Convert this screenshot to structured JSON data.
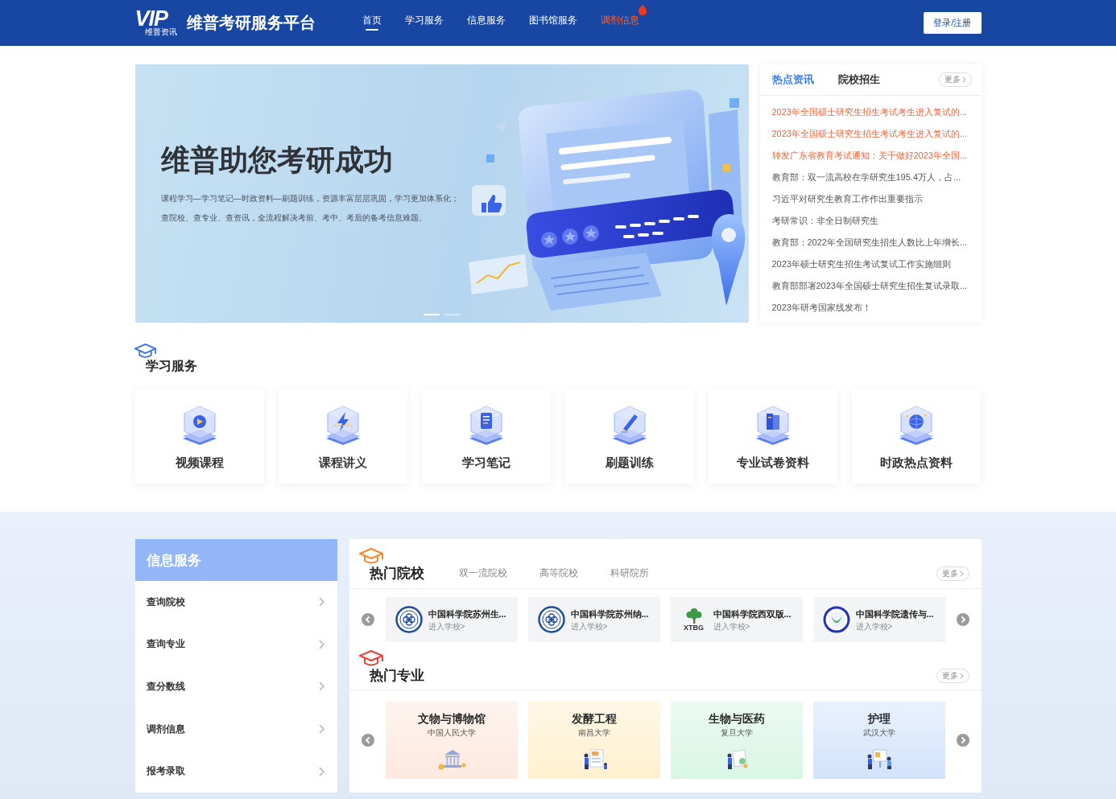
{
  "header": {
    "logo": {
      "mark": "VIP",
      "caption": "维普资讯"
    },
    "site_title": "维普考研服务平台",
    "nav": [
      {
        "label": "首页",
        "selected": true,
        "hot": false
      },
      {
        "label": "学习服务",
        "selected": false,
        "hot": false
      },
      {
        "label": "信息服务",
        "selected": false,
        "hot": false
      },
      {
        "label": "图书馆服务",
        "selected": false,
        "hot": false
      },
      {
        "label": "调剂信息",
        "selected": false,
        "hot": true
      }
    ],
    "login_button": "登录/注册"
  },
  "banner": {
    "title": "维普助您考研成功",
    "lines": [
      "课程学习—学习笔记—时政资料—刷题训练，资源丰富层层巩固，学习更加体系化；",
      "查院校、查专业、查资讯，全流程解决考前、考中、考后的备考信息难题。"
    ],
    "slides": [
      {
        "selected": true
      },
      {
        "selected": false
      }
    ]
  },
  "news": {
    "tabs": [
      {
        "label": "热点资讯",
        "selected": true
      },
      {
        "label": "院校招生",
        "selected": false
      }
    ],
    "more": "更多",
    "items": [
      {
        "text": "2023年全国硕士研究生招生考试考生进入复试的...",
        "highlighted": true
      },
      {
        "text": "2023年全国硕士研究生招生考试考生进入复试的...",
        "highlighted": true
      },
      {
        "text": "转发广东省教育考试通知：关于做好2023年全国...",
        "highlighted": true
      },
      {
        "text": "教育部：双一流高校在学研究生195.4万人，占...",
        "highlighted": false
      },
      {
        "text": "习近平对研究生教育工作作出重要指示",
        "highlighted": false
      },
      {
        "text": "考研常识：非全日制研究生",
        "highlighted": false
      },
      {
        "text": "教育部：2022年全国研究生招生人数比上年增长...",
        "highlighted": false
      },
      {
        "text": "2023年硕士研究生招生考试复试工作实施细则",
        "highlighted": false
      },
      {
        "text": "教育部部署2023年全国硕士研究生招生复试录取...",
        "highlighted": false
      },
      {
        "text": "2023年研考国家线发布！",
        "highlighted": false
      }
    ]
  },
  "study_services": {
    "title": "学习服务",
    "items": [
      {
        "label": "视频课程"
      },
      {
        "label": "课程讲义"
      },
      {
        "label": "学习笔记"
      },
      {
        "label": "刷题训练"
      },
      {
        "label": "专业试卷资料"
      },
      {
        "label": "时政热点资料"
      }
    ]
  },
  "info_services": {
    "title": "信息服务",
    "items": [
      "查询院校",
      "查询专业",
      "查分数线",
      "调剂信息",
      "报考录取"
    ]
  },
  "hot_schools": {
    "title": "热门院校",
    "tabs": [
      {
        "label": "双一流院校",
        "selected": false
      },
      {
        "label": "高等院校",
        "selected": false
      },
      {
        "label": "科研院所",
        "selected": false
      }
    ],
    "more": "更多",
    "schools": [
      {
        "name": "中国科学院苏州生...",
        "link": "进入学校>",
        "kind": "seal"
      },
      {
        "name": "中国科学院苏州纳...",
        "link": "进入学校>",
        "kind": "seal"
      },
      {
        "name": "中国科学院西双版...",
        "link": "进入学校>",
        "kind": "tree",
        "logo_text": "XTBG"
      },
      {
        "name": "中国科学院遗传与...",
        "link": "进入学校>",
        "kind": "leaf"
      }
    ]
  },
  "hot_majors": {
    "title": "热门专业",
    "more": "更多",
    "majors": [
      {
        "name": "文物与博物馆",
        "school": "中国人民大学",
        "color": "#fde9df"
      },
      {
        "name": "发酵工程",
        "school": "南昌大学",
        "color": "#fff1cf"
      },
      {
        "name": "生物与医药",
        "school": "复旦大学",
        "color": "#d9f6e5"
      },
      {
        "name": "护理",
        "school": "武汉大学",
        "color": "#d3e3fb"
      }
    ]
  }
}
